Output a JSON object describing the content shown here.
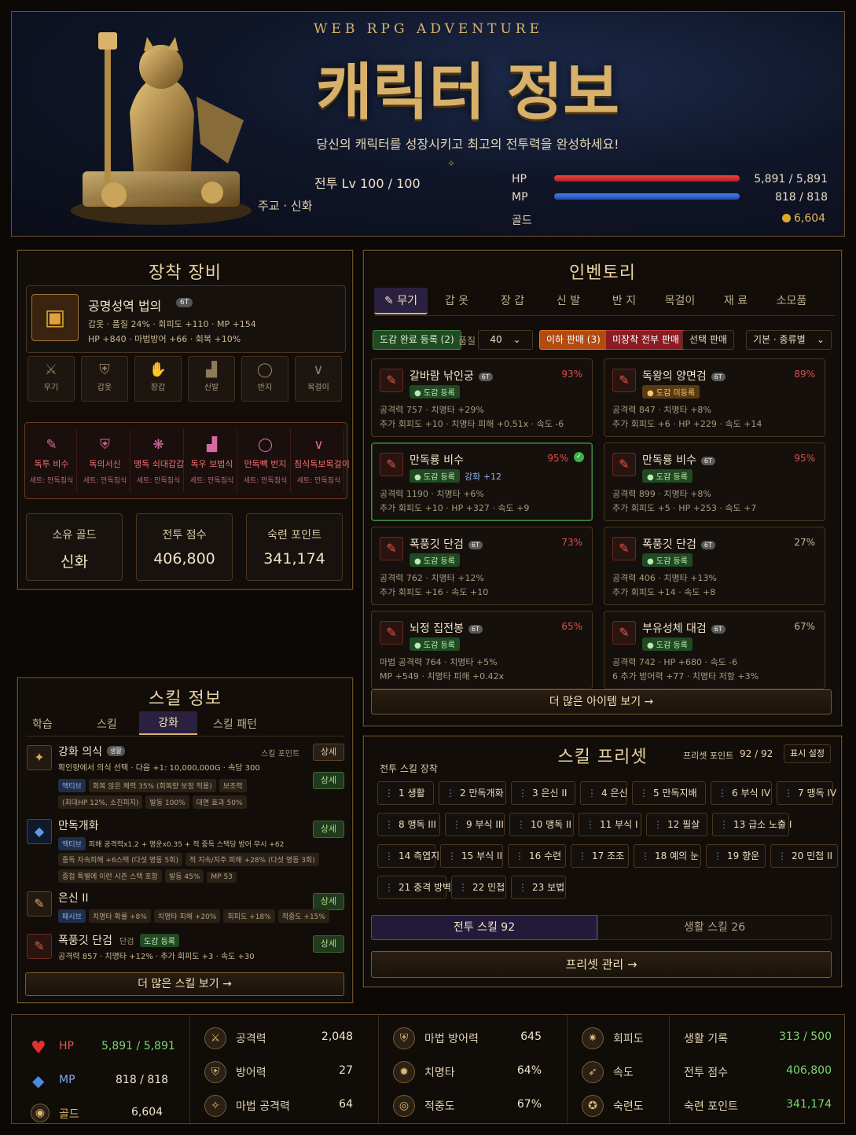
{
  "header": {
    "subtitle_top": "WEB RPG ADVENTURE",
    "title": "캐릭터 정보",
    "tagline": "당신의 캐릭터를 성장시키고 최고의 전투력을 완성하세요!",
    "level": "전투 Lv 100 / 100",
    "class": "주교 · 신화",
    "hp_label": "HP",
    "hp_value": "5,891 / 5,891",
    "hp_fill": 1.0,
    "mp_label": "MP",
    "mp_value": "818 / 818",
    "mp_fill": 1.0,
    "gold_label": "골드",
    "gold_value": "6,604"
  },
  "equipment": {
    "title": "장착 장비",
    "item_name": "공명성역 법의",
    "item_tier": "6T",
    "item_line1": "갑옷 · 품질 24% · 회피도 +110 · MP +154",
    "item_line2": "HP +840 · 마법방어 +66 · 회복 +10%",
    "slots": [
      {
        "icon": "sword-icon",
        "label": "무기"
      },
      {
        "icon": "shield-icon",
        "label": "갑옷"
      },
      {
        "icon": "gauntlet-icon",
        "label": "장갑"
      },
      {
        "icon": "boot-icon",
        "label": "신발"
      },
      {
        "icon": "ring-icon",
        "label": "반지"
      },
      {
        "icon": "necklace-icon",
        "label": "목걸이"
      }
    ],
    "sets": [
      {
        "name": "독투 비수",
        "sub": "세트: 만독침식"
      },
      {
        "name": "독의서신",
        "sub": "세트: 만독침식"
      },
      {
        "name": "맹독 쇠대갑갑",
        "sub": "세트: 만독침식"
      },
      {
        "name": "독우 보법식",
        "sub": "세트: 만독침식"
      },
      {
        "name": "만독빽 번지",
        "sub": "세트: 만독침식"
      },
      {
        "name": "침식독보목걸이",
        "sub": "세트: 만독침식"
      }
    ],
    "stats": [
      {
        "label": "소유 골드",
        "value": "신화"
      },
      {
        "label": "전투 점수",
        "value": "406,800"
      },
      {
        "label": "숙련 포인트",
        "value": "341,174"
      }
    ]
  },
  "inventory": {
    "title": "인벤토리",
    "tabs": [
      "무기",
      "갑 옷",
      "장 갑",
      "신 발",
      "반 지",
      "목걸이",
      "재 료",
      "소모품"
    ],
    "toolbar": {
      "register": "도감 완료 등록 (2)",
      "quality_label": "품질",
      "quality_value": "40",
      "sell_low": "이하 판매 (3)",
      "sell_all": "미장착 전부 판매",
      "sell_select": "선택 판매",
      "sort": "기본 · 종류별"
    },
    "items": [
      {
        "name": "갈바람 낚인궁",
        "tier": "6T",
        "badge": "도감 등록",
        "pct": "93%",
        "l1": "공격력 757 · 치명타 +29%",
        "l2": "추가 회피도 +10 · 치명타 피해 +0.51x · 속도 -6"
      },
      {
        "name": "독왕의 양면검",
        "tier": "6T",
        "badge": "도감 미등록",
        "pct": "89%",
        "l1": "공격력 847 · 치명타 +8%",
        "l2": "추가 회피도 +6 · HP +229 · 속도 +14"
      },
      {
        "name": "만독룡 비수",
        "tier": "",
        "badge": "도감 등록",
        "extra": "강화 +12",
        "pct": "95%",
        "l1": "공격력 1190 · 치명타 +6%",
        "l2": "추가 회피도 +10 · HP +327 · 속도 +9"
      },
      {
        "name": "만독룡 비수",
        "tier": "6T",
        "badge": "도감 등록",
        "pct": "95%",
        "l1": "공격력 899 · 치명타 +8%",
        "l2": "추가 회피도 +5 · HP +253 · 속도 +7"
      },
      {
        "name": "폭풍깃 단검",
        "tier": "6T",
        "badge": "도감 등록",
        "pct": "73%",
        "l1": "공격력 762 · 치명타 +12%",
        "l2": "추가 회피도 +16 · 속도 +10"
      },
      {
        "name": "폭풍깃 단검",
        "tier": "6T",
        "badge": "도감 등록",
        "pct": "27%",
        "l1": "공격력 406 · 치명타 +13%",
        "l2": "추가 회피도 +14 · 속도 +8"
      },
      {
        "name": "뇌정 집전봉",
        "tier": "6T",
        "badge": "도감 등록",
        "pct": "65%",
        "l1": "마법 공격력 764 · 치명타 +5%",
        "l2": "MP +549 · 치명타 피해 +0.42x"
      },
      {
        "name": "부유성체 대검",
        "tier": "6T",
        "badge": "도감 등록",
        "pct": "67%",
        "l1": "공격력 742 · HP +680 · 속도 -6",
        "l2": "6 추가 방어력 +77 · 치명타 저항 +3%"
      }
    ],
    "more": "더 많은 아이템 보기 →"
  },
  "skills": {
    "title": "스킬 정보",
    "tabs": [
      "학습",
      "스킬",
      "강화",
      "스킬 패턴"
    ],
    "s1": {
      "name": "강화 의식",
      "tag": "생활",
      "point": "스킬 포인트",
      "btn1": "상세",
      "btn2": "상세",
      "desc": "확인량에서 의식 선택 · 다음 +1: 10,000,000G · 속담 300",
      "p1": "액티브",
      "p2": "회복 않은 체력 35% (회복량 보정 적용)",
      "p3": "보조력",
      "p4": "(최대HP 12%, 소진피지)",
      "p5": "발동 100%",
      "p6": "대면 효과 50%"
    },
    "s2": {
      "name": "만독개화",
      "btn": "상세",
      "p1": "액티브",
      "p2": "피해 공격력x1.2 + 명운x0.35 + 적 중독 스택당 방어 무시 +62",
      "p3": "중독 자속피해 +6스택 (다섯 명동 5회)",
      "p4": "적 지속/지주 피해 +28% (다섯 명동 3회)",
      "p5": "중첩 특별에 이런 시즌 스택 포함",
      "p6": "발동 45%",
      "p7": "MP 53"
    },
    "s3": {
      "name": "은신 II",
      "btn": "상세",
      "p1": "패시브",
      "p2": "치명타 확률 +8%",
      "p3": "치명타 피해 +20%",
      "p4": "회피도 +18%",
      "p5": "적중도 +15%"
    },
    "s4": {
      "name": "폭풍깃 단검",
      "tag": "단검",
      "badge": "도감 등록",
      "btn": "상세",
      "desc": "공격력 857 · 치명타 +12% · 추가 회피도 +3 · 속도 +30"
    },
    "more": "더 많은 스킬 보기 →"
  },
  "preset": {
    "title": "스킬 프리셋",
    "points_label": "프리셋 포인트",
    "points": "92 / 92",
    "display_btn": "표시 설정",
    "equip_label": "전투 스킬 장착",
    "rows": [
      [
        "1 생활",
        "2 만독개화",
        "3 은신 II",
        "4 은신",
        "5 만독지배",
        "6 부식 IV",
        "7 맹독 IV"
      ],
      [
        "8 맹독 III",
        "9 부식 III",
        "10 맹독 II",
        "11 부식 I",
        "12 필살",
        "13 급소 노출 I"
      ],
      [
        "14 측엽지배",
        "15 부식 II",
        "16 수련",
        "17 조조",
        "18 예의 눈",
        "19 향운",
        "20 민첩 II"
      ],
      [
        "21 충격 방벽",
        "22 민첩",
        "23 보법"
      ]
    ],
    "tab_battle": "전투 스킬 92",
    "tab_life": "생활 스킬 26",
    "manage": "프리셋 관리 →"
  },
  "bottom": {
    "hp_label": "HP",
    "hp": "5,891 / 5,891",
    "mp_label": "MP",
    "mp": "818 / 818",
    "gold_label": "골드",
    "gold": "6,604",
    "c2": [
      {
        "icon": "sword-icon",
        "label": "공격력",
        "value": "2,048"
      },
      {
        "icon": "shield-icon",
        "label": "방어력",
        "value": "27"
      },
      {
        "icon": "magic-icon",
        "label": "마법 공격력",
        "value": "64"
      }
    ],
    "c3": [
      {
        "icon": "magic-shield-icon",
        "label": "마법 방어력",
        "value": "645"
      },
      {
        "icon": "crit-icon",
        "label": "치명타",
        "value": "64%"
      },
      {
        "icon": "target-icon",
        "label": "적중도",
        "value": "67%"
      }
    ],
    "c4": [
      {
        "icon": "dodge-icon",
        "label": "회피도"
      },
      {
        "icon": "speed-icon",
        "label": "속도"
      },
      {
        "icon": "mastery-icon",
        "label": "숙련도"
      }
    ],
    "c5": [
      {
        "label": "생활 기록",
        "value": "313 / 500"
      },
      {
        "label": "전투 점수",
        "value": "406,800"
      },
      {
        "label": "숙련 포인트",
        "value": "341,174"
      }
    ]
  },
  "colors": {
    "accent": "#d9b46a",
    "hp": "#d8262b",
    "mp": "#2d5fd0",
    "green": "#5fc974",
    "red": "#e05454"
  }
}
